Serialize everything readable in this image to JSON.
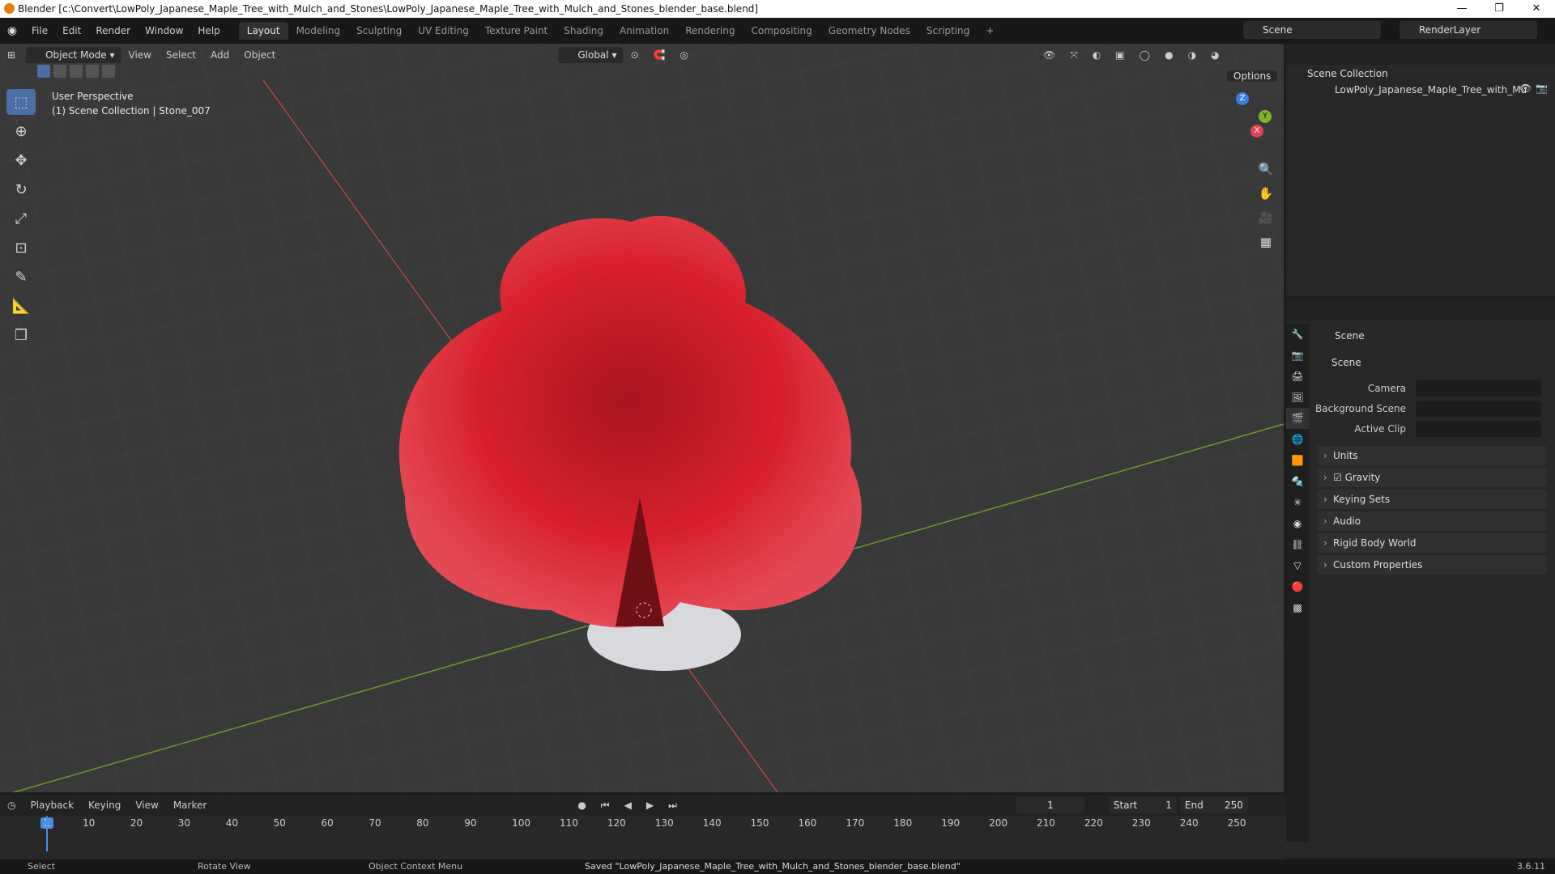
{
  "window": {
    "title": "Blender [c:\\Convert\\LowPoly_Japanese_Maple_Tree_with_Mulch_and_Stones\\LowPoly_Japanese_Maple_Tree_with_Mulch_and_Stones_blender_base.blend]",
    "minimize": "—",
    "maximize": "❐",
    "close": "✕"
  },
  "menu": [
    "File",
    "Edit",
    "Render",
    "Window",
    "Help"
  ],
  "workspaces": [
    "Layout",
    "Modeling",
    "Sculpting",
    "UV Editing",
    "Texture Paint",
    "Shading",
    "Animation",
    "Rendering",
    "Compositing",
    "Geometry Nodes",
    "Scripting",
    "+"
  ],
  "active_workspace": "Layout",
  "scene_selector": "Scene",
  "render_layer": "RenderLayer",
  "viewport": {
    "mode": "Object Mode",
    "menus": [
      "View",
      "Select",
      "Add",
      "Object"
    ],
    "transform_orientation": "Global",
    "options": "Options",
    "info_line1": "User Perspective",
    "info_line2": "(1) Scene Collection | Stone_007",
    "gizmo_x": "X",
    "gizmo_y": "Y",
    "gizmo_z": "Z"
  },
  "outliner": {
    "root": "Scene Collection",
    "item": "LowPoly_Japanese_Maple_Tree_with_Mu"
  },
  "properties": {
    "header": "Scene",
    "panel": "Scene",
    "camera_label": "Camera",
    "background_label": "Background Scene",
    "clip_label": "Active Clip",
    "subpanels": [
      "Units",
      "Gravity",
      "Keying Sets",
      "Audio",
      "Rigid Body World",
      "Custom Properties"
    ]
  },
  "timeline": {
    "menus": [
      "Playback",
      "Keying",
      "View",
      "Marker"
    ],
    "current_frame": "1",
    "start_label": "Start",
    "start": "1",
    "end_label": "End",
    "end": "250",
    "ticks": [
      "1",
      "10",
      "20",
      "30",
      "40",
      "50",
      "60",
      "70",
      "80",
      "90",
      "100",
      "110",
      "120",
      "130",
      "140",
      "150",
      "160",
      "170",
      "180",
      "190",
      "200",
      "210",
      "220",
      "230",
      "240",
      "250"
    ]
  },
  "statusbar": {
    "select": "Select",
    "rotate": "Rotate View",
    "context": "Object Context Menu",
    "message": "Saved \"LowPoly_Japanese_Maple_Tree_with_Mulch_and_Stones_blender_base.blend\"",
    "version": "3.6.11"
  },
  "colors": {
    "accent": "#4a6fa5",
    "foliage": "#d8202c",
    "axis_x": "#c84646",
    "axis_y": "#6b9a2c"
  }
}
